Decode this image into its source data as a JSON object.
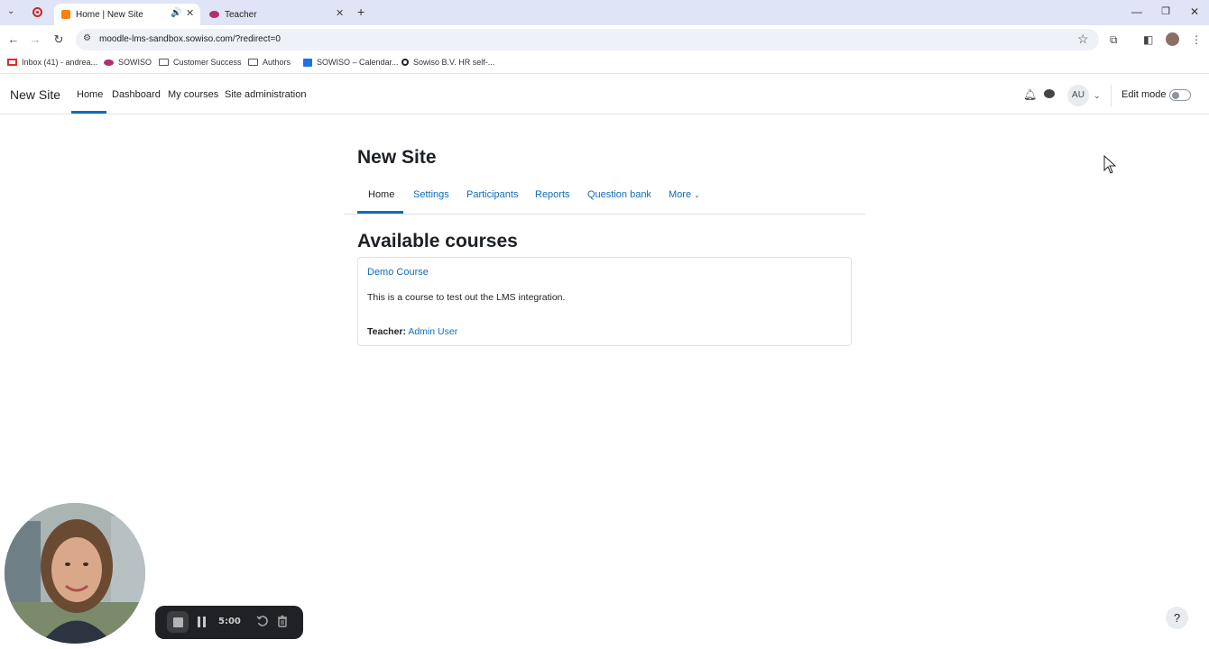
{
  "browser": {
    "tabs": [
      {
        "title": "Home | New Site",
        "active": true
      },
      {
        "title": "Teacher",
        "active": false
      }
    ],
    "url": "moodle-lms-sandbox.sowiso.com/?redirect=0",
    "bookmarks": [
      {
        "label": "Inbox (41) - andrea...",
        "icon": "gmail-icon"
      },
      {
        "label": "SOWISO",
        "icon": "sowiso-icon"
      },
      {
        "label": "Customer Success",
        "icon": "folder-icon"
      },
      {
        "label": "Authors",
        "icon": "folder-icon"
      },
      {
        "label": "SOWISO – Calendar...",
        "icon": "calendar-icon"
      },
      {
        "label": "Sowiso B.V. HR self-...",
        "icon": "hr-icon"
      }
    ]
  },
  "navbar": {
    "site_name": "New Site",
    "items": [
      "Home",
      "Dashboard",
      "My courses",
      "Site administration"
    ],
    "avatar_initials": "AU",
    "edit_mode_label": "Edit mode",
    "edit_mode_on": false
  },
  "page": {
    "title": "New Site",
    "secondary_nav": [
      "Home",
      "Settings",
      "Participants",
      "Reports",
      "Question bank",
      "More"
    ],
    "courses_heading": "Available courses",
    "course": {
      "name": "Demo Course",
      "summary": "This is a course to test out the LMS integration.",
      "teacher_label": "Teacher:",
      "teacher_name": "Admin User"
    }
  },
  "recorder": {
    "time": "5:00"
  },
  "help": {
    "label": "?"
  },
  "colors": {
    "link": "#0f6cbf",
    "tabstrip": "#dfe5f6",
    "recorder_bg": "#202124"
  }
}
